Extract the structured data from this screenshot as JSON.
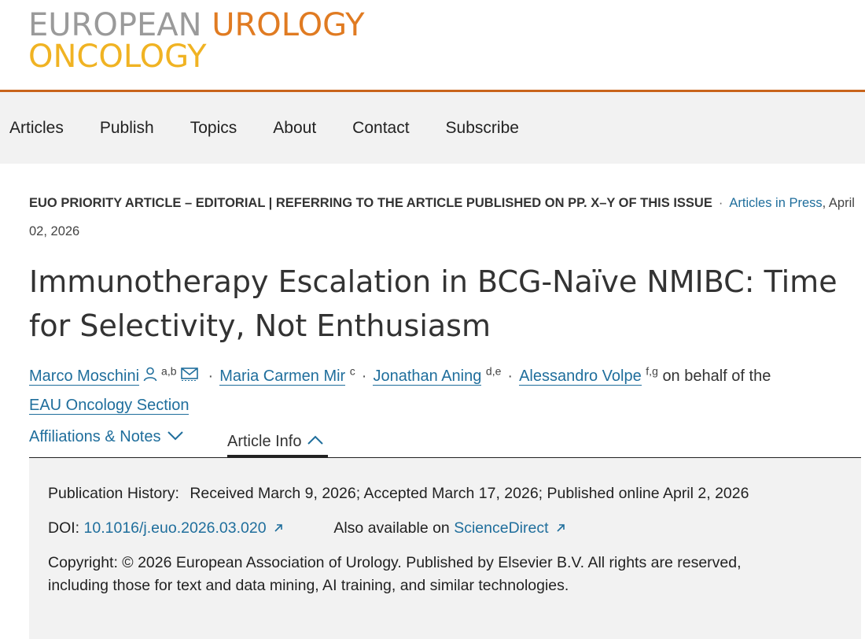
{
  "logo": {
    "word1": "EUROPEAN",
    "word2": "UROLOGY",
    "word3": "ONCOLOGY",
    "colors": {
      "grey": "#9a9a9a",
      "orange": "#e07b22",
      "yellow": "#f0b323"
    }
  },
  "nav": {
    "items": [
      "Articles",
      "Publish",
      "Topics",
      "About",
      "Contact",
      "Subscribe"
    ]
  },
  "article": {
    "category": "EUO PRIORITY ARTICLE – EDITORIAL | REFERRING TO THE ARTICLE PUBLISHED ON PP. X–Y OF THIS ISSUE",
    "separator": "·",
    "issue_link": "Articles in Press",
    "date": ", April 02, 2026",
    "title": "Immunotherapy Escalation in BCG-Naïve NMIBC: Time for Selectivity, Not Enthusiasm",
    "authors": [
      {
        "name": "Marco Moschini",
        "sup": "a,b"
      },
      {
        "name": "Maria Carmen Mir",
        "sup": "c"
      },
      {
        "name": "Jonathan Aning",
        "sup": "d,e"
      },
      {
        "name": "Alessandro Volpe",
        "sup": "f,g"
      }
    ],
    "behalf_text": "on behalf of the",
    "group_link": "EAU Oncology Section"
  },
  "tabs": {
    "affiliations": "Affiliations & Notes",
    "article_info": "Article Info"
  },
  "info": {
    "history_label": "Publication History:",
    "history_value": "Received March 9, 2026; Accepted March 17, 2026; Published online April 2, 2026",
    "doi_label": "DOI:",
    "doi_value": "10.1016/j.euo.2026.03.020",
    "also_label": "Also available on",
    "also_link": "ScienceDirect",
    "copyright_label": "Copyright:",
    "copyright_value": "© 2026 European Association of Urology. Published by Elsevier B.V. All rights are reserved, including those for text and data mining, AI training, and similar technologies."
  },
  "colors": {
    "accent_orange": "#c9641c",
    "link_blue": "#1f6e9c",
    "panel_grey": "#f2f2f2"
  },
  "icons": {
    "author_person": "person-icon",
    "author_mail": "envelope-icon",
    "external": "external-link-icon",
    "chevron_down": "chevron-down-icon",
    "chevron_up": "chevron-up-icon"
  }
}
